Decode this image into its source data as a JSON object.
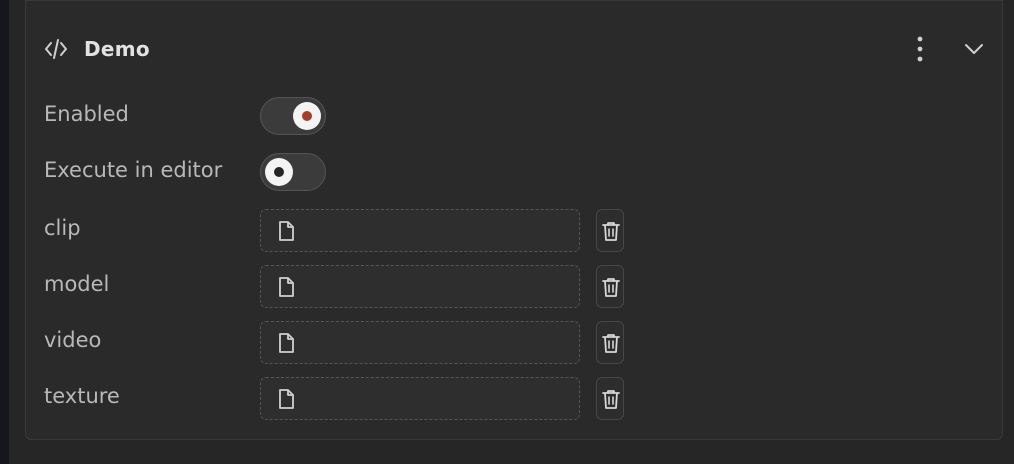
{
  "component": {
    "title": "Demo",
    "icons": {
      "header": "code-icon",
      "menu": "more-vertical-icon",
      "collapse": "chevron-down-icon",
      "file": "file-icon",
      "delete": "trash-icon"
    }
  },
  "toggles": [
    {
      "label": "Enabled",
      "on": true
    },
    {
      "label": "Execute in editor",
      "on": false
    }
  ],
  "fields": [
    {
      "label": "clip",
      "value": ""
    },
    {
      "label": "model",
      "value": ""
    },
    {
      "label": "video",
      "value": ""
    },
    {
      "label": "texture",
      "value": ""
    }
  ],
  "colors": {
    "accent": "#a63d2a",
    "toggle_off_dot": "#262626",
    "panel_bg": "#2a2a2a",
    "text": "#b8b8b8",
    "title": "#e2e2e2"
  }
}
